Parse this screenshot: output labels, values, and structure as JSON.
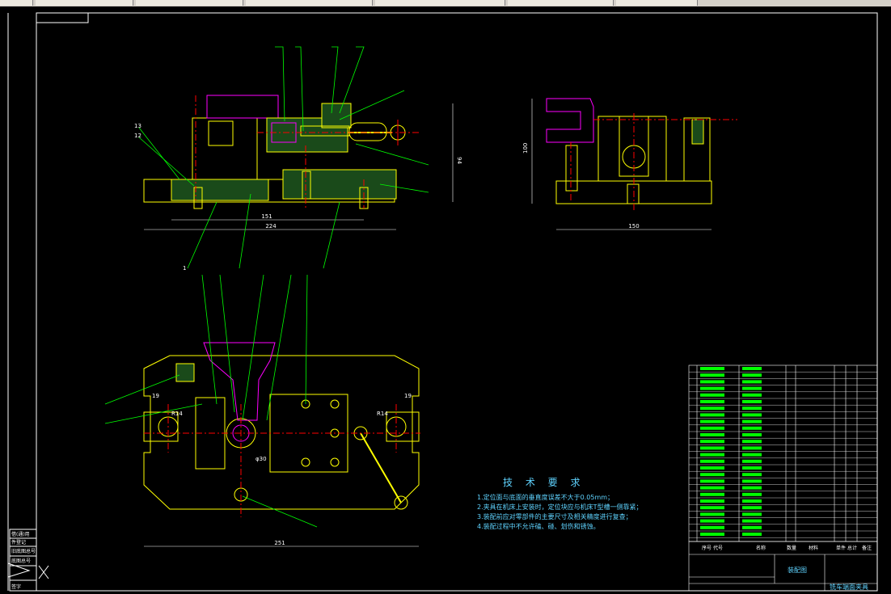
{
  "technical_requirements": {
    "title": "技 术 要 求",
    "items": [
      "1.定位面与底面的垂直度误差不大于0.05mm；",
      "2.夹具在机床上安装时，定位块应与机床T型槽一侧靠紧；",
      "3.装配前应对零部件的主要尺寸及相关精度进行复查；",
      "4.装配过程中不允许磕、碰、划伤和锈蚀。"
    ]
  },
  "dimensions": {
    "front_151": "151",
    "front_224": "224",
    "front_94": "94",
    "side_150": "150",
    "side_100": "100",
    "top_251": "251",
    "top_19_left": "19",
    "top_19_right": "19",
    "top_r14_left": "R14",
    "top_r14_right": "R14",
    "top_phi30": "φ30"
  },
  "balloons": {
    "top_row": [
      "",
      "",
      "",
      ""
    ],
    "front_left": [
      "13",
      "12"
    ],
    "bottom_row": [
      "1",
      "",
      "",
      "",
      "",
      "",
      ""
    ],
    "left_side": [
      "",
      ""
    ]
  },
  "title_block": {
    "drawing_name": "装配图",
    "part_title": "铣车端面夹具",
    "header_cols": [
      "序号",
      "代号",
      "名称",
      "数量",
      "材料",
      "单件",
      "总计",
      "备注"
    ]
  },
  "left_stamp": {
    "lines": [
      "借(通)用",
      "件登记",
      "旧底图总号",
      "底图总号",
      "签字"
    ]
  },
  "colors": {
    "background": "#000000",
    "outline": "#ffff00",
    "frame": "#ffffff",
    "leader": "#00ff00",
    "center": "#ff0000",
    "hidden": "#ff00ff",
    "text_cyan": "#5fd3ff"
  }
}
